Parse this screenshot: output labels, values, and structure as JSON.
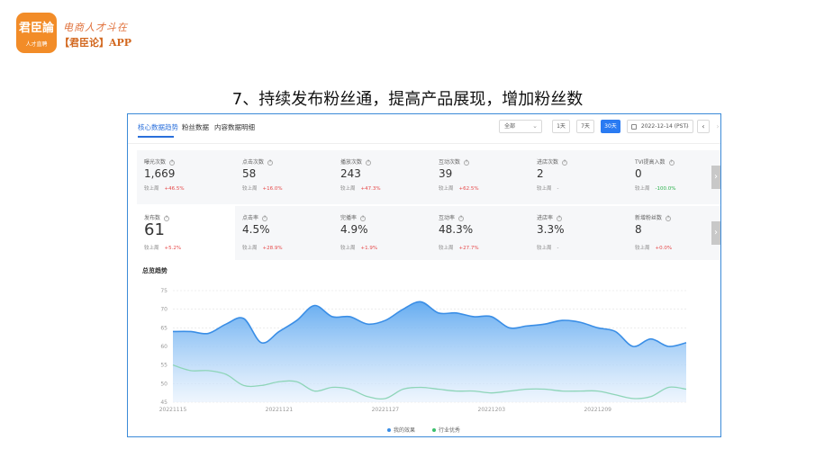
{
  "brand": {
    "logo_text": "君臣論",
    "logo_subtext": "人才直聘",
    "slogan": "电商人才斗在",
    "app_name": "【君臣论】APP"
  },
  "slide": {
    "title": "7、持续发布粉丝通，提高产品展现，增加粉丝数"
  },
  "tabs": [
    {
      "label": "核心数据趋势",
      "active": true
    },
    {
      "label": "粉丝数据",
      "active": false
    },
    {
      "label": "内容数据明细",
      "active": false
    }
  ],
  "controls": {
    "filter_selected": "全部",
    "range_buttons": [
      "1天",
      "7天",
      "30天"
    ],
    "active_range": "30天",
    "date": "2022-12-14 (PST)"
  },
  "metrics_row1": [
    {
      "label": "曝光次数",
      "value": "1,669",
      "compare_label": "较上周",
      "delta": "+46.5%",
      "delta_type": "up"
    },
    {
      "label": "点击次数",
      "value": "58",
      "compare_label": "较上周",
      "delta": "+16.0%",
      "delta_type": "up"
    },
    {
      "label": "播放次数",
      "value": "243",
      "compare_label": "较上周",
      "delta": "+47.3%",
      "delta_type": "up"
    },
    {
      "label": "互动次数",
      "value": "39",
      "compare_label": "较上周",
      "delta": "+62.5%",
      "delta_type": "up"
    },
    {
      "label": "进店次数",
      "value": "2",
      "compare_label": "较上周",
      "delta": "-",
      "delta_type": "flat"
    },
    {
      "label": "TVI提高入数",
      "value": "0",
      "compare_label": "较上周",
      "delta": "-100.0%",
      "delta_type": "green"
    }
  ],
  "metrics_row2": [
    {
      "label": "发布数",
      "value": "61",
      "compare_label": "较上周",
      "delta": "+5.2%",
      "delta_type": "up",
      "selected": true
    },
    {
      "label": "点击率",
      "value": "4.5%",
      "compare_label": "较上周",
      "delta": "+28.9%",
      "delta_type": "up"
    },
    {
      "label": "完播率",
      "value": "4.9%",
      "compare_label": "较上周",
      "delta": "+1.9%",
      "delta_type": "up"
    },
    {
      "label": "互动率",
      "value": "48.3%",
      "compare_label": "较上周",
      "delta": "+27.7%",
      "delta_type": "up"
    },
    {
      "label": "进店率",
      "value": "3.3%",
      "compare_label": "较上周",
      "delta": "-",
      "delta_type": "flat"
    },
    {
      "label": "新增粉丝数",
      "value": "8",
      "compare_label": "较上周",
      "delta": "+0.0%",
      "delta_type": "up"
    }
  ],
  "trend_title": "总览趋势",
  "chart_data": {
    "type": "area",
    "x": [
      "20221115",
      "20221116",
      "20221117",
      "20221118",
      "20221119",
      "20221120",
      "20221121",
      "20221122",
      "20221123",
      "20221124",
      "20221125",
      "20221126",
      "20221127",
      "20221128",
      "20221129",
      "20221130",
      "20221201",
      "20221202",
      "20221203",
      "20221204",
      "20221205",
      "20221206",
      "20221207",
      "20221208",
      "20221209",
      "20221210",
      "20221211",
      "20221212",
      "20221213",
      "20221214"
    ],
    "x_tick_labels": [
      "20221115",
      "20221121",
      "20221127",
      "20221203",
      "20221209"
    ],
    "y_ticks": [
      45,
      50,
      55,
      60,
      65,
      70,
      75
    ],
    "ylim": [
      45,
      75
    ],
    "grid": true,
    "legend_position": "bottom",
    "series": [
      {
        "name": "我的效果",
        "color": "#3a8ee6",
        "values": [
          64,
          64,
          63.5,
          66,
          67.5,
          61,
          64,
          67,
          71,
          68,
          68,
          66,
          67,
          70,
          72,
          69,
          69,
          68,
          68,
          65,
          65.5,
          66,
          67,
          66.5,
          65,
          64,
          60,
          62,
          60,
          61
        ]
      },
      {
        "name": "行业优秀",
        "color": "#8ed5b8",
        "values": [
          55,
          53.5,
          53.5,
          52.5,
          49.5,
          49.5,
          50.5,
          50.5,
          48,
          49,
          48.5,
          46.5,
          46,
          48.5,
          49,
          48.5,
          48,
          48,
          47.5,
          48,
          48.5,
          48.5,
          48,
          48,
          48,
          47,
          46,
          46.5,
          49,
          48.5
        ]
      }
    ]
  }
}
